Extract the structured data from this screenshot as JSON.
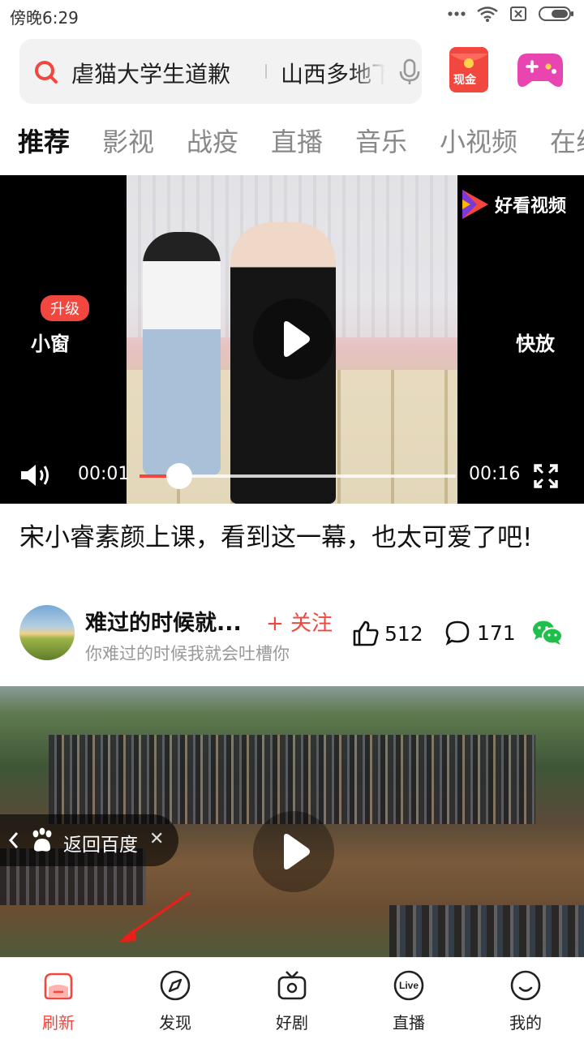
{
  "status_bar": {
    "time": "傍晚6:29"
  },
  "search": {
    "query_1": "虐猫大学生道歉",
    "query_2": "山西多地下"
  },
  "cash_badge": "现金",
  "tabs": [
    "推荐",
    "影视",
    "战疫",
    "直播",
    "音乐",
    "小视频",
    "在线"
  ],
  "video1": {
    "brand": "好看视频",
    "upgrade_badge": "升级",
    "mini_window": "小窗",
    "fast_forward": "快放",
    "current_time": "00:01",
    "duration": "00:16",
    "progress": 0.125
  },
  "post1": {
    "title": "宋小睿素颜上课，看到这一幕，也太可爱了吧!",
    "author": "难过的时候就...",
    "follow": "+ 关注",
    "subtitle": "你难过的时候我就会吐槽你",
    "likes": "512",
    "comments": "171"
  },
  "video2": {
    "back_label": "返回百度"
  },
  "nav": [
    {
      "label": "刷新",
      "icon": "home-refresh-icon",
      "active": true
    },
    {
      "label": "发现",
      "icon": "compass-icon",
      "active": false
    },
    {
      "label": "好剧",
      "icon": "tv-icon",
      "active": false
    },
    {
      "label": "直播",
      "icon": "live-icon",
      "active": false
    },
    {
      "label": "我的",
      "icon": "smile-face-icon",
      "active": false
    }
  ],
  "colors": {
    "accent": "#f2473f",
    "wechat": "#1fbf4b",
    "game": "#e845b0"
  }
}
